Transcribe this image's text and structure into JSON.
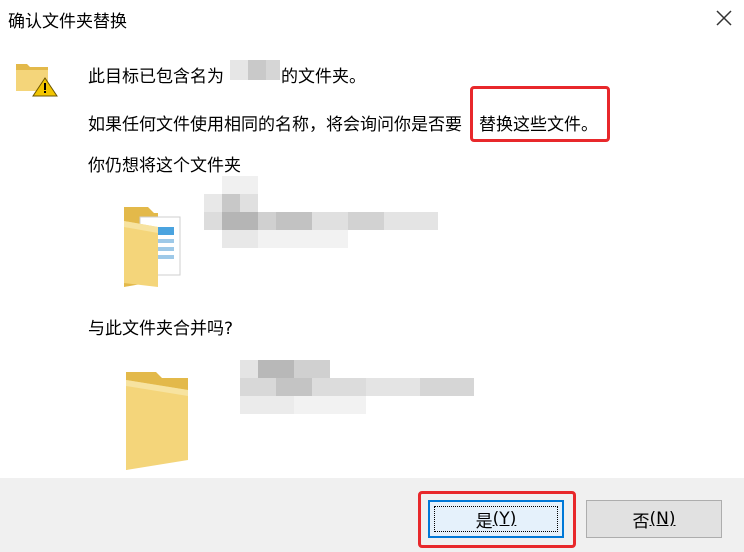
{
  "window": {
    "title": "确认文件夹替换"
  },
  "message": {
    "line1_prefix": "此目标已包含名为",
    "line1_suffix": "的文件夹。",
    "line2_a": "如果任何文件使用相同的名称，将会询问你是否要",
    "line2_b": "替换这些文件。",
    "question1": "你仍想将这个文件夹",
    "question2": "与此文件夹合并吗?"
  },
  "buttons": {
    "yes_label": "是",
    "yes_key": "(Y)",
    "no_label": "否",
    "no_key": "(N)"
  },
  "icons": {
    "warning": "folder-warning-icon",
    "source": "folder-with-files-icon",
    "destination": "folder-icon",
    "close": "close-icon"
  },
  "colors": {
    "accent": "#0078d7",
    "highlight": "#e8282b",
    "folder": "#f4d57a"
  }
}
